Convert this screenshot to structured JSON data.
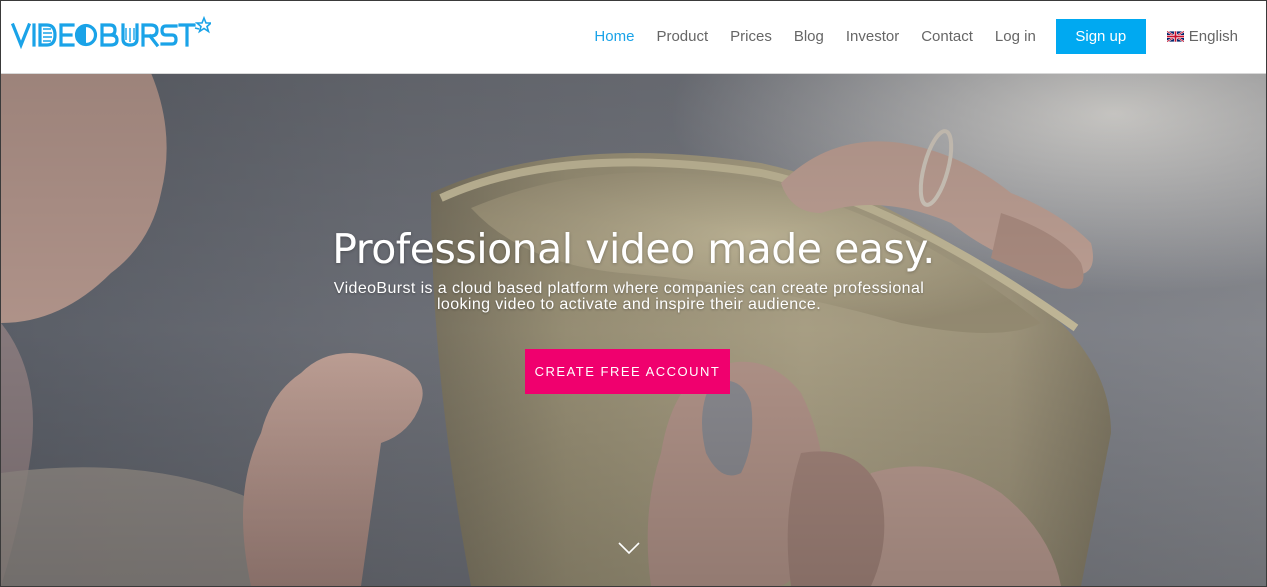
{
  "brand": {
    "name": "VideoBurst",
    "logo_text": "VIDEOBURST",
    "logo_color": "#1aa3e8"
  },
  "nav": {
    "items": [
      {
        "label": "Home",
        "active": true
      },
      {
        "label": "Product",
        "active": false
      },
      {
        "label": "Prices",
        "active": false
      },
      {
        "label": "Blog",
        "active": false
      },
      {
        "label": "Investor",
        "active": false
      },
      {
        "label": "Contact",
        "active": false
      },
      {
        "label": "Log in",
        "active": false
      }
    ],
    "signup_label": "Sign up",
    "signup_color": "#00a9f1",
    "language": {
      "label": "English",
      "flag_icon": "uk-flag-icon"
    }
  },
  "hero": {
    "title": "Professional video made easy.",
    "subtitle_line1": "VideoBurst is a cloud based platform where companies can create professional",
    "subtitle_line2": "looking video to activate and inspire their audience.",
    "cta_label": "CREATE FREE ACCOUNT",
    "cta_color": "#f0006e",
    "scroll_icon": "chevron-down-icon"
  }
}
